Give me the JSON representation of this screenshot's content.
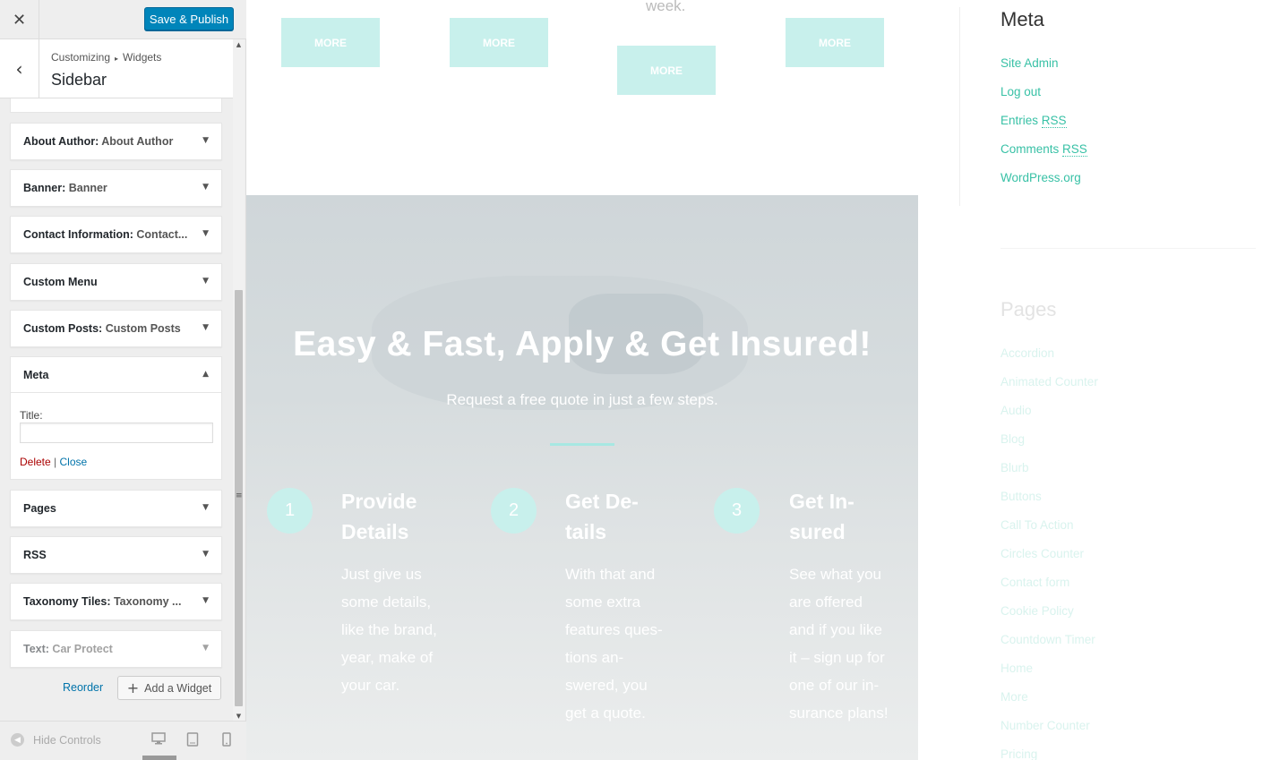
{
  "customizer": {
    "close_label": "✕",
    "publish_label": "Save & Publish",
    "back_label": "‹",
    "breadcrumb": {
      "part1": "Customizing",
      "separator": "▸",
      "part2": "Widgets"
    },
    "section_title": "Sidebar",
    "widgets": [
      {
        "name": "About Author",
        "sub": "About Author"
      },
      {
        "name": "Banner",
        "sub": "Banner"
      },
      {
        "name": "Contact Information",
        "sub": "Contact..."
      },
      {
        "name": "Custom Menu",
        "sub": ""
      },
      {
        "name": "Custom Posts",
        "sub": "Custom Posts"
      },
      {
        "name": "Pages",
        "sub": ""
      },
      {
        "name": "RSS",
        "sub": ""
      },
      {
        "name": "Taxonomy Tiles",
        "sub": "Taxonomy ..."
      },
      {
        "name": "Text",
        "sub": "Car Protect"
      }
    ],
    "open_widget": {
      "name": "Meta",
      "field_label": "Title:",
      "field_value": "",
      "delete_label": "Delete",
      "divider": "|",
      "close_label": "Close"
    },
    "arrow_down": "▼",
    "arrow_up": "▲",
    "reorder_label": "Reorder",
    "add_widget_plus": "+",
    "add_widget_label": "Add a Widget",
    "hide_controls_icon": "◀",
    "hide_controls_label": "Hide Controls",
    "scroll_up": "▲",
    "scroll_down": "▼",
    "resize_glyph": "≡",
    "devices": {
      "desktop_icon": "desktop-icon",
      "tablet_icon": "tablet-icon",
      "mobile_icon": "mobile-icon"
    }
  },
  "preview": {
    "week_text": "week.",
    "more_label": "MORE",
    "hero": {
      "title": "Easy & Fast, Apply & Get Insured!",
      "subtitle": "Request a free quote in just a few steps.",
      "steps": [
        {
          "num": "1",
          "title": "Provide\nDetails",
          "text": "Just give us\nsome details,\nlike the brand,\nyear, make of\nyour car."
        },
        {
          "num": "2",
          "title": "Get De-\ntails",
          "text": "With that and\nsome extra\nfeatures ques-\ntions an-\nswered, you\nget a quote."
        },
        {
          "num": "3",
          "title": "Get In-\nsured",
          "text": "See what you\nare offered\nand if you like\nit – sign up for\none of our in-\nsurance plans!"
        }
      ]
    },
    "meta": {
      "title": "Meta",
      "links": {
        "site_admin": "Site Admin",
        "log_out": "Log out",
        "entries": "Entries",
        "comments": "Comments",
        "rss": "RSS",
        "wordpress": "WordPress.org"
      }
    },
    "pages": {
      "title": "Pages",
      "links": [
        "Accordion",
        "Animated Counter",
        "Audio",
        "Blog",
        "Blurb",
        "Buttons",
        "Call To Action",
        "Circles Counter",
        "Contact form",
        "Cookie Policy",
        "Countdown Timer",
        "Home",
        "More",
        "Number Counter",
        "Pricing"
      ]
    },
    "colors": {
      "accent": "#38c1a6",
      "button": "#c8f0ec",
      "publish": "#0085ba"
    }
  }
}
